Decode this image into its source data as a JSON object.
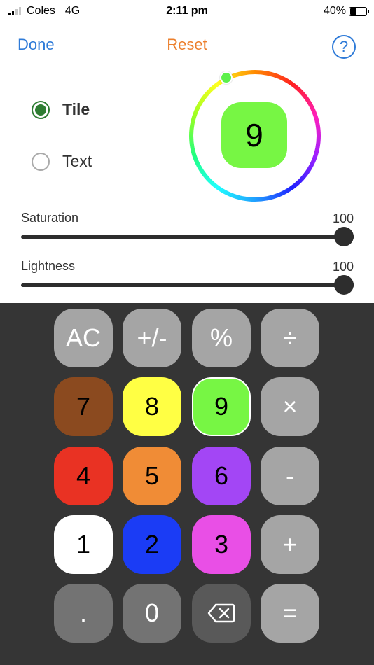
{
  "status_bar": {
    "carrier": "Coles",
    "network": "4G",
    "time": "2:11 pm",
    "battery": "40%"
  },
  "toolbar": {
    "done_label": "Done",
    "reset_label": "Reset",
    "help_label": "?"
  },
  "target_options": {
    "tile_label": "Tile",
    "text_label": "Text",
    "selected": "Tile"
  },
  "preview": {
    "digit": "9",
    "color": "#77f644"
  },
  "sliders": {
    "saturation": {
      "label": "Saturation",
      "value": "100"
    },
    "lightness": {
      "label": "Lightness",
      "value": "100"
    }
  },
  "keypad": {
    "ac": {
      "label": "AC",
      "color": "#a5a5a5"
    },
    "plus_minus": {
      "label": "+/-",
      "color": "#a5a5a5"
    },
    "percent": {
      "label": "%",
      "color": "#a5a5a5"
    },
    "divide": {
      "label": "÷",
      "color": "#a5a5a5"
    },
    "seven": {
      "label": "7",
      "color": "#8b4a1f"
    },
    "eight": {
      "label": "8",
      "color": "#ffff44"
    },
    "nine": {
      "label": "9",
      "color": "#77f644"
    },
    "multiply": {
      "label": "×",
      "color": "#a5a5a5"
    },
    "four": {
      "label": "4",
      "color": "#e93223"
    },
    "five": {
      "label": "5",
      "color": "#f08c36"
    },
    "six": {
      "label": "6",
      "color": "#a346f5"
    },
    "minus": {
      "label": "-",
      "color": "#a5a5a5"
    },
    "one": {
      "label": "1",
      "color": "#ffffff"
    },
    "two": {
      "label": "2",
      "color": "#1b3cf5"
    },
    "three": {
      "label": "3",
      "color": "#e94fe6"
    },
    "plus": {
      "label": "+",
      "color": "#a5a5a5"
    },
    "decimal": {
      "label": ".",
      "color": "#737373"
    },
    "zero": {
      "label": "0",
      "color": "#737373"
    },
    "backspace_icon": "backspace-icon",
    "equals": {
      "label": "=",
      "color": "#a5a5a5"
    }
  },
  "colors": {
    "accent_blue": "#2f7bd8",
    "accent_orange": "#ec7f2c",
    "radio_green": "#2e7d32",
    "keypad_background": "#353535"
  }
}
